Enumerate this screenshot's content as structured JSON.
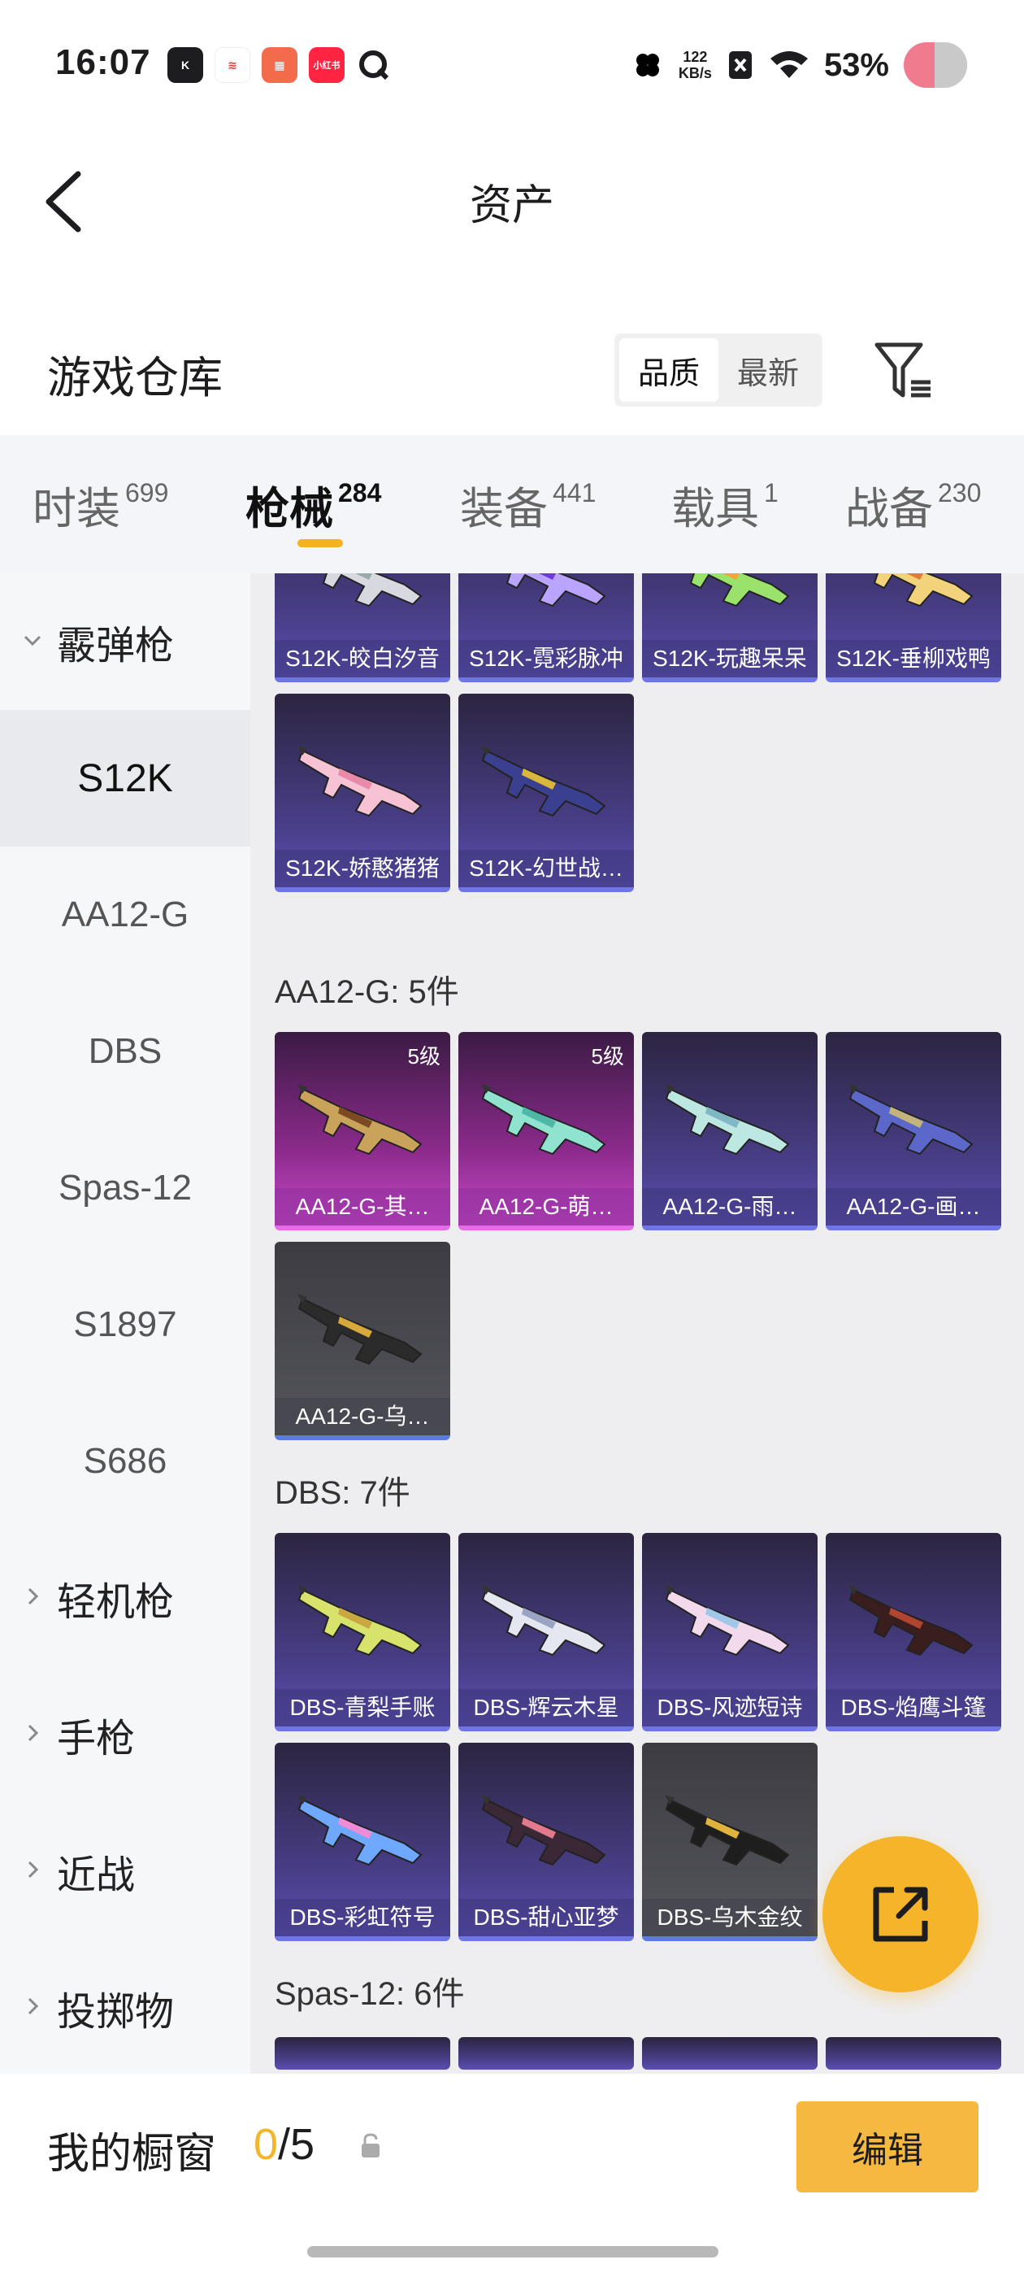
{
  "status": {
    "time": "16:07",
    "net_speed_value": "122",
    "net_speed_unit": "KB/s",
    "battery": "53%",
    "app_icons": [
      "kwai-icon",
      "notes-icon",
      "gallery-icon",
      "xiaohongshu-icon",
      "search-app-icon"
    ],
    "xhs_label": "小红书"
  },
  "nav": {
    "title": "资产"
  },
  "header": {
    "title": "游戏仓库",
    "sort_options": [
      "品质",
      "最新"
    ],
    "sort_selected": "品质"
  },
  "tabs": [
    {
      "label": "时装",
      "count": "699"
    },
    {
      "label": "枪械",
      "count": "284",
      "active": true
    },
    {
      "label": "装备",
      "count": "441"
    },
    {
      "label": "载具",
      "count": "1"
    },
    {
      "label": "战备",
      "count": "230"
    }
  ],
  "sidebar": {
    "categories": [
      {
        "label": "霰弹枪",
        "expanded": true
      },
      {
        "label": "轻机枪"
      },
      {
        "label": "手枪"
      },
      {
        "label": "近战"
      },
      {
        "label": "投掷物"
      }
    ],
    "subitems": [
      "S12K",
      "AA12-G",
      "DBS",
      "Spas-12",
      "S1897",
      "S686"
    ],
    "selected": "S12K"
  },
  "groups": {
    "s12k_cards": [
      {
        "name": "S12K-皎白汐音",
        "color": "#d8d8e0",
        "accent": "#9aa"
      },
      {
        "name": "S12K-霓彩脉冲",
        "color": "#b9a4ff",
        "accent": "#6e3ad6"
      },
      {
        "name": "S12K-玩趣呆呆",
        "color": "#9be26c",
        "accent": "#f5a33a"
      },
      {
        "name": "S12K-垂柳戏鸭",
        "color": "#f2d27a",
        "accent": "#e07b3a"
      },
      {
        "name": "S12K-娇憨猪猪",
        "color": "#f6c2d4",
        "accent": "#e98aaa"
      },
      {
        "name": "S12K-幻世战…",
        "color": "#3a3f8f",
        "accent": "#d9b63c"
      }
    ],
    "aa12": {
      "label": "AA12-G: 5件",
      "cards": [
        {
          "name": "AA12-G-其…",
          "level": "5级",
          "tier": "pink",
          "color": "#caa35a",
          "accent": "#7c4a22"
        },
        {
          "name": "AA12-G-萌…",
          "level": "5级",
          "tier": "pink",
          "color": "#8fe3cf",
          "accent": "#4fb7a8"
        },
        {
          "name": "AA12-G-雨…",
          "color": "#bde8e2",
          "accent": "#7fb8c4"
        },
        {
          "name": "AA12-G-画…",
          "color": "#5b68c9",
          "accent": "#c4b37a"
        },
        {
          "name": "AA12-G-乌…",
          "tier": "gray",
          "color": "#2b2b2b",
          "accent": "#d7a93a"
        }
      ]
    },
    "dbs": {
      "label": "DBS: 7件",
      "cards": [
        {
          "name": "DBS-青梨手账",
          "color": "#d7e36b",
          "accent": "#c9a844"
        },
        {
          "name": "DBS-辉云木星",
          "color": "#e4e7f0",
          "accent": "#9aa3c4"
        },
        {
          "name": "DBS-风迹短诗",
          "color": "#f2d9ec",
          "accent": "#9fc7e8"
        },
        {
          "name": "DBS-焰鹰斗篷",
          "color": "#3a1d1d",
          "accent": "#b0452f"
        },
        {
          "name": "DBS-彩虹符号",
          "color": "#6fa8ff",
          "accent": "#f08bd6"
        },
        {
          "name": "DBS-甜心亚梦",
          "color": "#3b2836",
          "accent": "#e07a8c"
        },
        {
          "name": "DBS-乌木金纹",
          "tier": "gray",
          "color": "#1e1e1e",
          "accent": "#e0b43c"
        }
      ]
    },
    "spas": {
      "label": "Spas-12: 6件"
    }
  },
  "bottom": {
    "title": "我的橱窗",
    "current": "0",
    "total": "/5",
    "edit_label": "编辑"
  }
}
